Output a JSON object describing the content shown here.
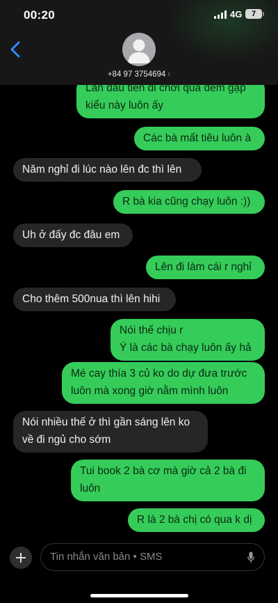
{
  "status_bar": {
    "time": "00:20",
    "network": "4G",
    "battery": "7"
  },
  "header": {
    "contact": "+84 97 3754694",
    "contact_chevron": "›"
  },
  "messages": [
    {
      "direction": "out",
      "text": "Lần đầu tiên đi chơi qua đêm gặp\nkiểu này luôn ấy"
    },
    {
      "direction": "out",
      "text": "Các bà mất tiêu luôn à"
    },
    {
      "direction": "in",
      "text": "Năm nghỉ đi lúc nào lên đc thì lên"
    },
    {
      "direction": "out",
      "text": "R bà kia cũng chạy luôn :))"
    },
    {
      "direction": "in",
      "text": "Uh ở đấy đc đâu em"
    },
    {
      "direction": "out",
      "text": "Lên đi làm cái r nghỉ"
    },
    {
      "direction": "in",
      "text": "Cho thêm 500nua thì lên hihi"
    },
    {
      "direction": "out",
      "text": "Nói thế chịu r\nÝ là các bà chạy luôn ấy hả"
    },
    {
      "direction": "out",
      "text": "Mé cay thía 3 củ ko do dự đưa trước\nluôn mà xong giờ nằm mình luôn"
    },
    {
      "direction": "in",
      "text": "Nói nhiều thế ở thì gần sáng lên ko\nvề đi ngủ cho sớm"
    },
    {
      "direction": "out",
      "text": "Tui book 2 bà cơ mà giờ cả 2 bà đi\nluôn"
    },
    {
      "direction": "out",
      "text": "R là 2 bà chị có qua k dị"
    }
  ],
  "composer": {
    "placeholder": "Tin nhắn văn bản • SMS"
  },
  "colors": {
    "outgoing": "#36cc5a",
    "incoming": "#262626",
    "background": "#000000"
  }
}
